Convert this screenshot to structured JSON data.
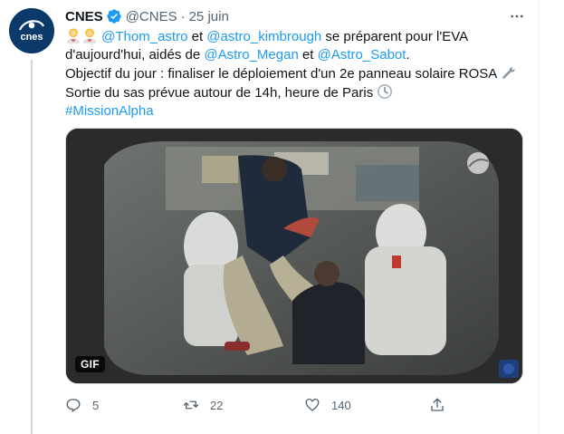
{
  "tweet": {
    "author_name": "CNES",
    "author_handle": "@CNES",
    "separator": "·",
    "date": "25 juin",
    "verified": true,
    "avatar_text": "cnes",
    "body": {
      "line1": {
        "emoji": [
          "astronaut-man-emoji",
          "astronaut-man-emoji"
        ],
        "mention1": "@Thom_astro",
        "text1": " et ",
        "mention2": "@astro_kimbrough",
        "text2": " se préparent pour l'EVA"
      },
      "line2": {
        "text1": "d'aujourd'hui, aidés de ",
        "mention1": "@Astro_Megan",
        "text2": " et ",
        "mention2": "@Astro_Sabot",
        "text3": "."
      },
      "line3": {
        "text": "Objectif du jour : finaliser le déploiement d'un 2e panneau solaire ROSA ",
        "icon": "wrench-icon"
      },
      "line4": {
        "text": "Sortie du sas prévue autour de 14h, heure de Paris ",
        "icon": "clock-icon"
      },
      "line5": {
        "hashtag": "#MissionAlpha"
      }
    },
    "media": {
      "badge": "GIF"
    },
    "actions": {
      "reply_count": "5",
      "retweet_count": "22",
      "like_count": "140"
    }
  },
  "colors": {
    "link": "#1d9bf0",
    "secondary_text": "#536471",
    "primary_text": "#0f1419",
    "verified": "#1d9bf0",
    "avatar_bg": "#0b3a6a"
  }
}
